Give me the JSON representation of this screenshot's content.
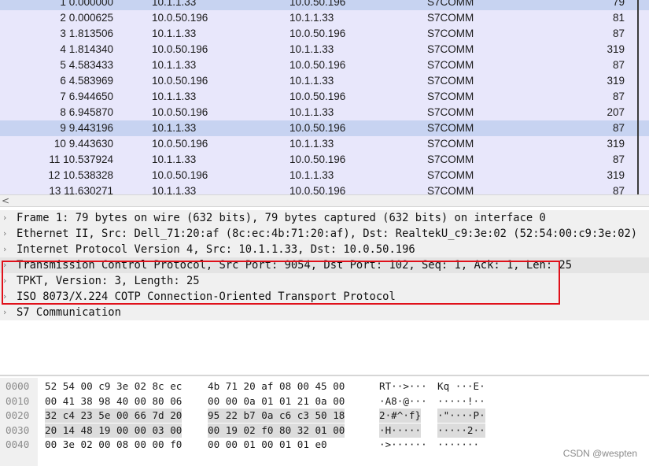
{
  "packets": [
    {
      "no": "1",
      "time": "0.000000",
      "src": "10.1.1.33",
      "dst": "10.0.50.196",
      "proto": "S7COMM",
      "len": "79"
    },
    {
      "no": "2",
      "time": "0.000625",
      "src": "10.0.50.196",
      "dst": "10.1.1.33",
      "proto": "S7COMM",
      "len": "81"
    },
    {
      "no": "3",
      "time": "1.813506",
      "src": "10.1.1.33",
      "dst": "10.0.50.196",
      "proto": "S7COMM",
      "len": "87"
    },
    {
      "no": "4",
      "time": "1.814340",
      "src": "10.0.50.196",
      "dst": "10.1.1.33",
      "proto": "S7COMM",
      "len": "319"
    },
    {
      "no": "5",
      "time": "4.583433",
      "src": "10.1.1.33",
      "dst": "10.0.50.196",
      "proto": "S7COMM",
      "len": "87"
    },
    {
      "no": "6",
      "time": "4.583969",
      "src": "10.0.50.196",
      "dst": "10.1.1.33",
      "proto": "S7COMM",
      "len": "319"
    },
    {
      "no": "7",
      "time": "6.944650",
      "src": "10.1.1.33",
      "dst": "10.0.50.196",
      "proto": "S7COMM",
      "len": "87"
    },
    {
      "no": "8",
      "time": "6.945870",
      "src": "10.0.50.196",
      "dst": "10.1.1.33",
      "proto": "S7COMM",
      "len": "207"
    },
    {
      "no": "9",
      "time": "9.443196",
      "src": "10.1.1.33",
      "dst": "10.0.50.196",
      "proto": "S7COMM",
      "len": "87"
    },
    {
      "no": "10",
      "time": "9.443630",
      "src": "10.0.50.196",
      "dst": "10.1.1.33",
      "proto": "S7COMM",
      "len": "319"
    },
    {
      "no": "11",
      "time": "10.537924",
      "src": "10.1.1.33",
      "dst": "10.0.50.196",
      "proto": "S7COMM",
      "len": "87"
    },
    {
      "no": "12",
      "time": "10.538328",
      "src": "10.0.50.196",
      "dst": "10.1.1.33",
      "proto": "S7COMM",
      "len": "319"
    },
    {
      "no": "13",
      "time": "11.630271",
      "src": "10.1.1.33",
      "dst": "10.0.50.196",
      "proto": "S7COMM",
      "len": "87"
    }
  ],
  "selected_packet_index": 8,
  "hscroll": {
    "left_arrow_icon": "chevron-left-icon",
    "arrow_glyph": "<"
  },
  "details": [
    {
      "text": "Frame 1: 79 bytes on wire (632 bits), 79 bytes captured (632 bits) on interface 0"
    },
    {
      "text": "Ethernet II, Src: Dell_71:20:af (8c:ec:4b:71:20:af), Dst: RealtekU_c9:3e:02 (52:54:00:c9:3e:02)"
    },
    {
      "text": "Internet Protocol Version 4, Src: 10.1.1.33, Dst: 10.0.50.196"
    },
    {
      "text": "Transmission Control Protocol, Src Port: 9054, Dst Port: 102, Seq: 1, Ack: 1, Len: 25"
    },
    {
      "text": "TPKT, Version: 3, Length: 25"
    },
    {
      "text": "ISO 8073/X.224 COTP Connection-Oriented Transport Protocol"
    },
    {
      "text": "S7 Communication"
    }
  ],
  "bytes": [
    {
      "off": "0000",
      "hex1": "52 54 00 c9 3e 02 8c ec",
      "hex2": "4b 71 20 af 08 00 45 00",
      "asc1": "RT··>···",
      "asc2": "Kq ···E·"
    },
    {
      "off": "0010",
      "hex1": "00 41 38 98 40 00 80 06",
      "hex2": "00 00 0a 01 01 21 0a 00",
      "asc1": "·A8·@···",
      "asc2": "·····!··"
    },
    {
      "off": "0020",
      "hex1": "32 c4 23 5e 00 66 7d 20",
      "hex2": "95 22 b7 0a c6 c3 50 18",
      "asc1": "2·#^·f} ",
      "asc2": "·\"····P·"
    },
    {
      "off": "0030",
      "hex1": "20 14 48 19 00 00 03 00",
      "hex2": "00 19 02 f0 80 32 01 00",
      "asc1": " ·H·····",
      "asc2": "·····2··"
    },
    {
      "off": "0040",
      "hex1": "00 3e 02 00 08 00 00 f0",
      "hex2": "00 00 01 00 01 01 e0",
      "asc1": "·>······",
      "asc2": "·······"
    }
  ],
  "watermark": "CSDN @wespten",
  "colors": {
    "highlight_box": "#e0101a",
    "selected_row": "#c7d3f1",
    "row_bg": "#e8e7fb"
  }
}
